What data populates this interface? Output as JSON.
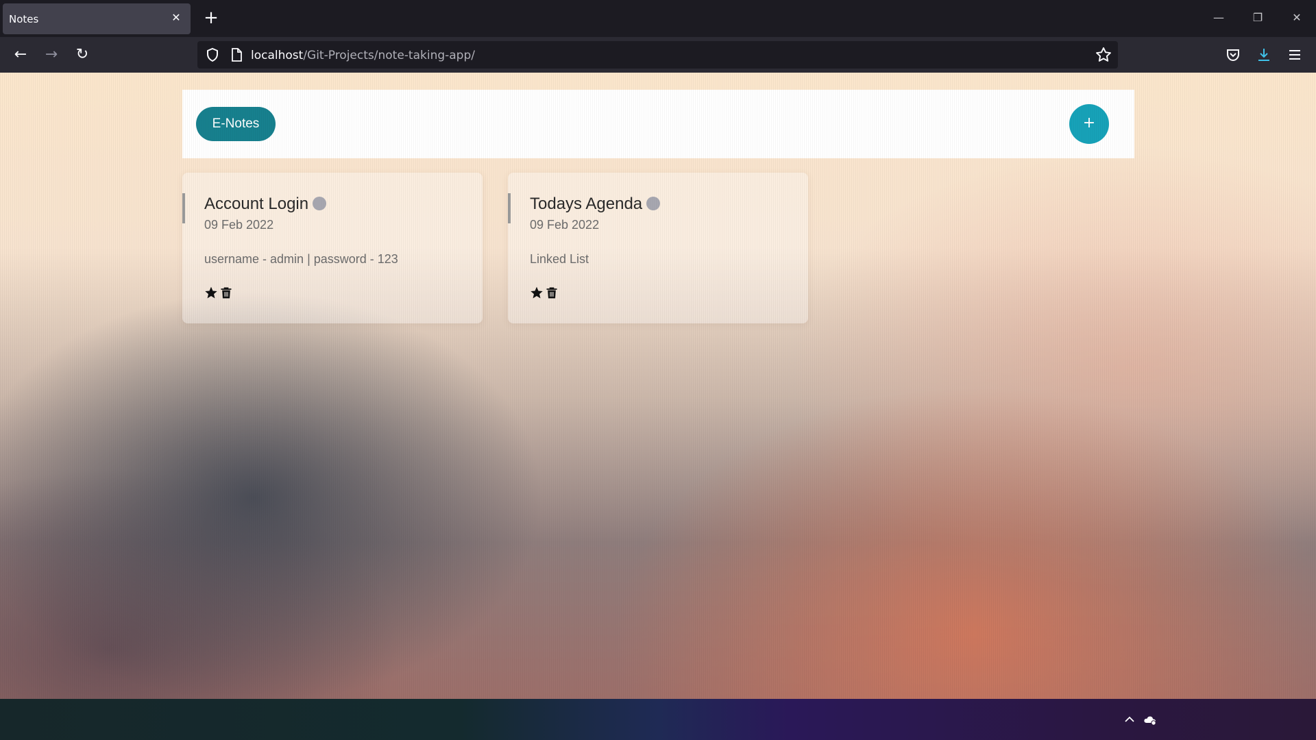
{
  "browser": {
    "tab_title": "Notes",
    "tab_close_glyph": "✕",
    "new_tab_glyph": "+",
    "window_controls": {
      "minimize": "—",
      "restore": "❐",
      "close": "✕"
    },
    "nav": {
      "back": "←",
      "forward": "→",
      "reload": "↻"
    },
    "url_host": "localhost",
    "url_path": "/Git-Projects/note-taking-app/",
    "icons": [
      "shield-icon",
      "page-icon",
      "bookmark-star-icon",
      "pocket-icon",
      "download-icon",
      "menu-icon"
    ],
    "download_icon_color": "#3fc1e8"
  },
  "app": {
    "brand": "E-Notes",
    "add_glyph": "+",
    "brand_color": "#17808e",
    "add_color": "#17a2b8"
  },
  "notes": [
    {
      "title": "Account Login",
      "date": "09 Feb 2022",
      "body": "username - admin | password - 123",
      "actions": [
        "star-icon",
        "trash-icon"
      ]
    },
    {
      "title": "Todays Agenda",
      "date": "09 Feb 2022",
      "body": "Linked List",
      "actions": [
        "star-icon",
        "trash-icon"
      ]
    }
  ],
  "taskbar": {
    "icons": [
      "chevron-up-icon",
      "weather-icon"
    ]
  }
}
